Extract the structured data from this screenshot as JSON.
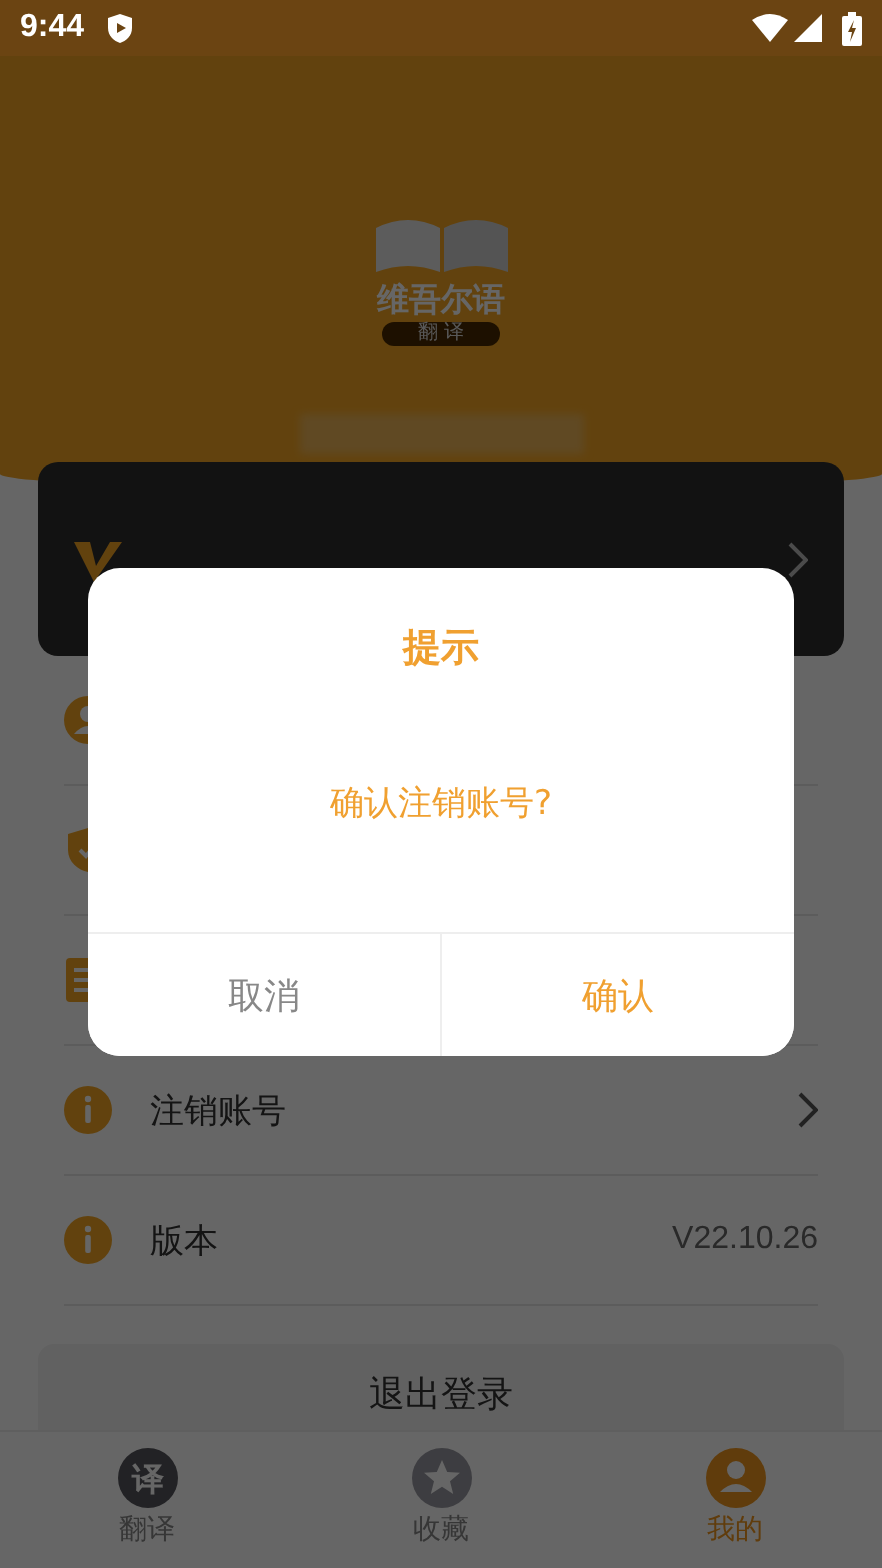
{
  "status_bar": {
    "time": "9:44"
  },
  "header": {
    "logo_title": "维吾尔语",
    "logo_subtitle": "翻 译"
  },
  "member_card": {
    "chevron": true
  },
  "menu": [
    {
      "kind": "user"
    },
    {
      "kind": "shield"
    },
    {
      "kind": "list"
    },
    {
      "kind": "info",
      "label": "注销账号",
      "chevron": true
    },
    {
      "kind": "info",
      "label": "版本",
      "value": "V22.10.26"
    }
  ],
  "logout_button": "退出登录",
  "bottom_nav": [
    {
      "kind": "translate",
      "icon_text": "译",
      "label": "翻译",
      "selected": false
    },
    {
      "kind": "star",
      "label": "收藏",
      "selected": false
    },
    {
      "kind": "person",
      "label": "我的",
      "selected": true
    }
  ],
  "dialog": {
    "title": "提示",
    "message": "确认注销账号?",
    "buttons": [
      {
        "kind": "cancel",
        "label": "取消"
      },
      {
        "kind": "confirm",
        "label": "确认"
      }
    ]
  }
}
